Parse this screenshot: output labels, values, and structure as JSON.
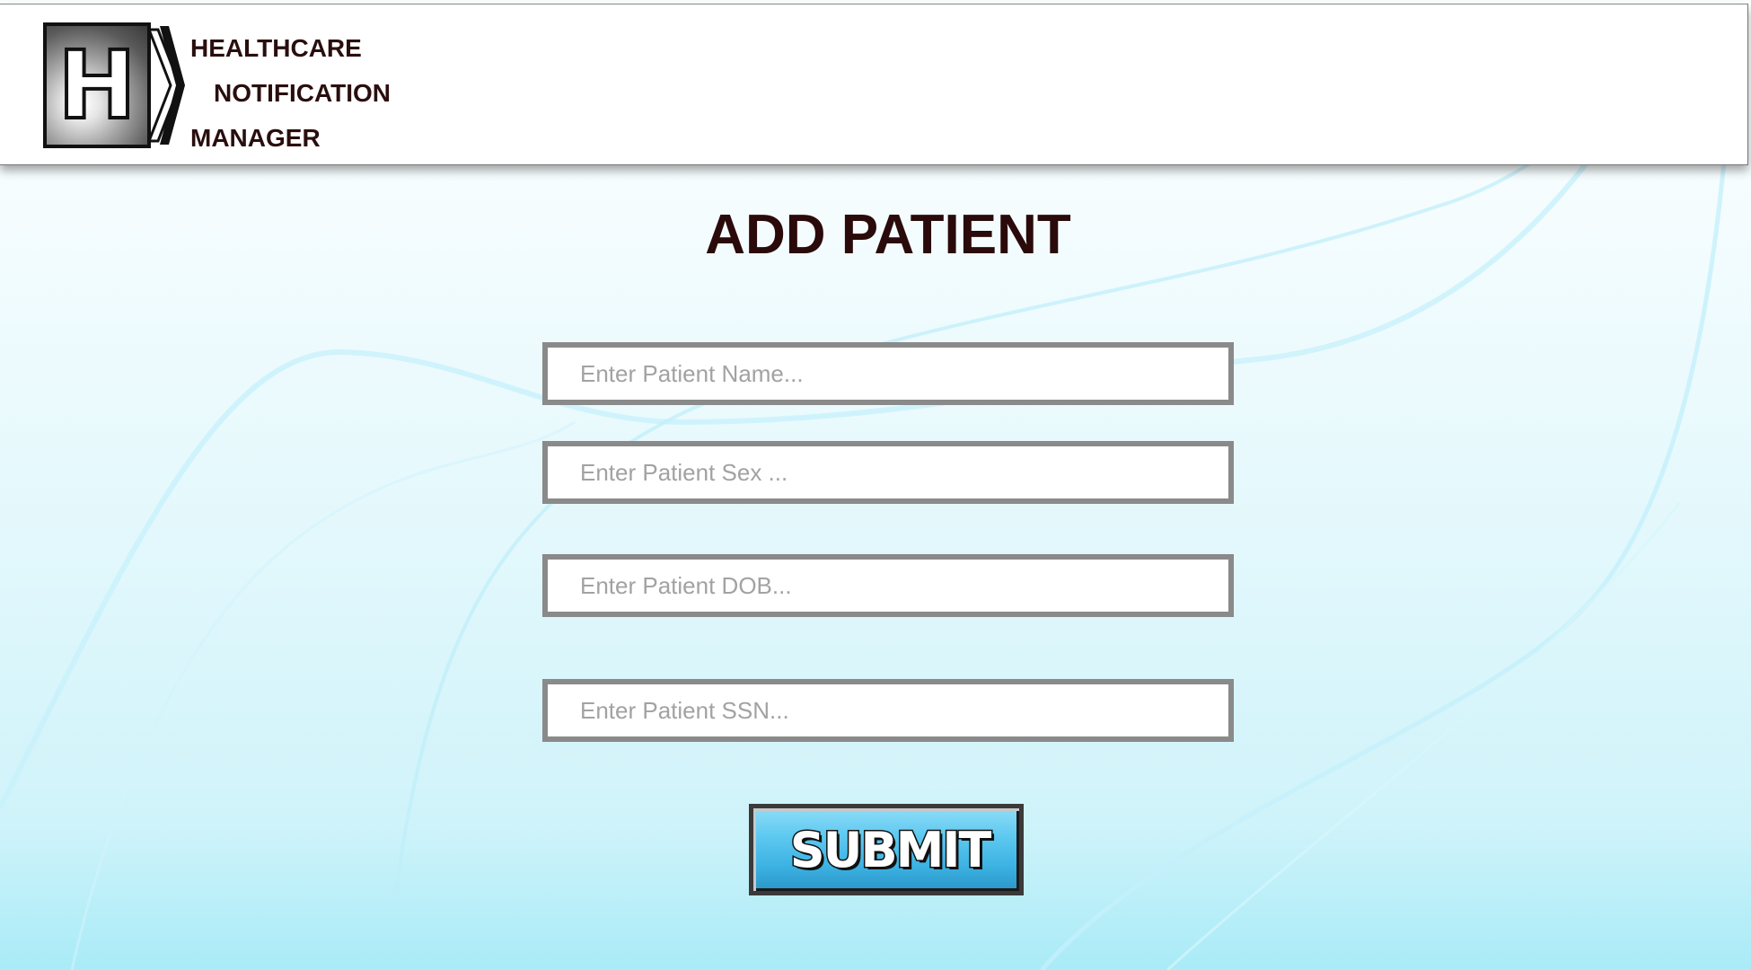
{
  "header": {
    "logo_letter": "H",
    "brand_lines": [
      "HEALTHCARE",
      "NOTIFICATION",
      "MANAGER"
    ]
  },
  "main": {
    "title": "ADD PATIENT",
    "fields": [
      {
        "placeholder": "Enter Patient Name...",
        "value": ""
      },
      {
        "placeholder": "Enter Patient Sex ...",
        "value": ""
      },
      {
        "placeholder": "Enter Patient DOB...",
        "value": ""
      },
      {
        "placeholder": "Enter Patient SSN...",
        "value": ""
      }
    ],
    "submit_label": "SUBMIT"
  },
  "colors": {
    "title_text": "#2a0a0a",
    "field_border": "#8a8a8a",
    "submit_blue": "#3cb2e3",
    "background_cyan": "#a9ebf7"
  },
  "icons": {
    "logo": "hospital-h-icon",
    "chevrons": "chevron-right-icon"
  }
}
